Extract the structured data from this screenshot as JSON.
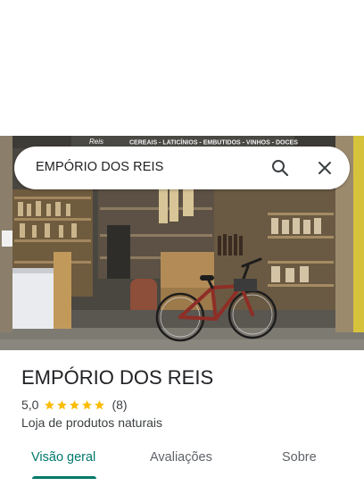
{
  "search": {
    "query": "EMPÓRIO DOS REIS",
    "search_icon": "search-icon",
    "close_icon": "close-icon"
  },
  "photo": {
    "sign_text": "CEREAIS - LATICÍNIOS - EMBUTIDOS - VINHOS - DOCES",
    "sign_logo": "Reis"
  },
  "place": {
    "title": "EMPÓRIO DOS REIS",
    "rating": "5,0",
    "stars": 5,
    "review_count": "(8)",
    "category": "Loja de produtos naturais"
  },
  "tabs": [
    {
      "label": "Visão geral",
      "active": true
    },
    {
      "label": "Avaliações",
      "active": false
    },
    {
      "label": "Sobre",
      "active": false
    }
  ],
  "colors": {
    "accent": "#00796b",
    "star": "#fbbc04",
    "text": "#202124",
    "secondary_text": "#5f6368"
  }
}
